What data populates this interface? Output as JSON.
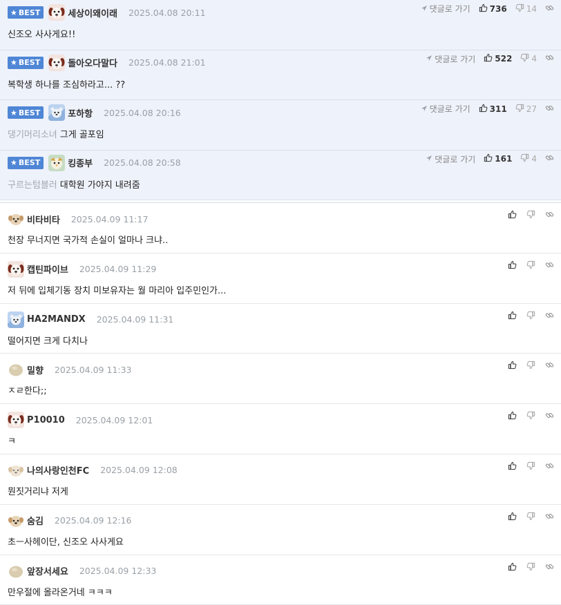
{
  "best_comments": [
    {
      "badge": "BEST",
      "nick": "세상이왜이래",
      "date": "2025.04.08 20:11",
      "reply_label": "댓글로 가기",
      "likes": "736",
      "dislikes": "14",
      "reply_to": "",
      "text": "신조오 사사게요!!",
      "avatar": "dog"
    },
    {
      "badge": "BEST",
      "nick": "돌아오다말다",
      "date": "2025.04.08 21:01",
      "reply_label": "댓글로 가기",
      "likes": "522",
      "dislikes": "4",
      "reply_to": "",
      "text": "복학생 하나를 조심하라고... ??",
      "avatar": "dog"
    },
    {
      "badge": "BEST",
      "nick": "포하항",
      "date": "2025.04.08 20:16",
      "reply_label": "댓글로 가기",
      "likes": "311",
      "dislikes": "27",
      "reply_to": "댕기머리소녀",
      "text": "그게 골포임",
      "avatar": "bear"
    },
    {
      "badge": "BEST",
      "nick": "킹종부",
      "date": "2025.04.08 20:58",
      "reply_label": "댓글로 가기",
      "likes": "161",
      "dislikes": "4",
      "reply_to": "구르는텀블러",
      "text": "대학원 가야지 내려줌",
      "avatar": "bird"
    }
  ],
  "comments": [
    {
      "nick": "비타비타",
      "date": "2025.04.09 11:17",
      "text": "천장 무너지면 국가적 손실이 얼마나 크냐..",
      "avatar": "puppy"
    },
    {
      "nick": "캡틴파이브",
      "date": "2025.04.09 11:29",
      "text": "저 뒤에 입체기동 장치 미보유자는 월 마리아 입주민인가...",
      "avatar": "dog"
    },
    {
      "nick": "HA2MANDX",
      "date": "2025.04.09 11:31",
      "text": "떨어지면 크게 다치나",
      "avatar": "bear"
    },
    {
      "nick": "밀향",
      "date": "2025.04.09 11:33",
      "text": "ㅈㄹ한다;;",
      "avatar": "egg"
    },
    {
      "nick": "P10010",
      "date": "2025.04.09 12:01",
      "text": "ㅋ",
      "avatar": "dog"
    },
    {
      "nick": "나의사랑인천FC",
      "date": "2025.04.09 12:08",
      "text": "뭔짓거리냐 저게",
      "avatar": "pale"
    },
    {
      "nick": "숨김",
      "date": "2025.04.09 12:16",
      "text": "초ㅡ사헤이단, 신조오 사사게요",
      "avatar": "puppy"
    },
    {
      "nick": "앞장서세요",
      "date": "2025.04.09 12:33",
      "text": "만우절에 올라온거네 ㅋㅋㅋ",
      "avatar": "egg"
    }
  ],
  "colors": {
    "best_bg": "#eef2fa",
    "badge": "#4f86d6"
  },
  "icons": {
    "reply": "arrow-icon",
    "up": "thumbs-up-icon",
    "down": "thumbs-down-icon",
    "link": "link-icon"
  }
}
